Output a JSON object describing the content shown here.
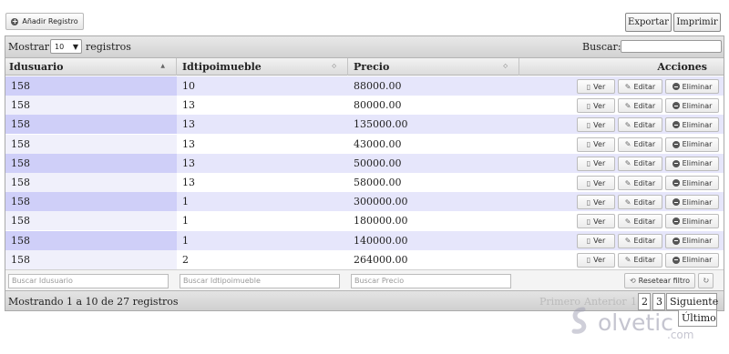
{
  "top": {
    "add_label": "Añadir Registro",
    "export_label": "Exportar",
    "print_label": "Imprimir"
  },
  "toolbar": {
    "show_label": "Mostrar",
    "page_length": "10",
    "records_label": "registros",
    "search_label": "Buscar:",
    "search_value": ""
  },
  "columns": {
    "c1": "Idusuario",
    "c2": "Idtipoimueble",
    "c3": "Precio",
    "c4": "Acciones"
  },
  "rows": [
    [
      "158",
      "10",
      "88000.00"
    ],
    [
      "158",
      "13",
      "80000.00"
    ],
    [
      "158",
      "13",
      "135000.00"
    ],
    [
      "158",
      "13",
      "43000.00"
    ],
    [
      "158",
      "13",
      "50000.00"
    ],
    [
      "158",
      "13",
      "58000.00"
    ],
    [
      "158",
      "1",
      "300000.00"
    ],
    [
      "158",
      "1",
      "180000.00"
    ],
    [
      "158",
      "1",
      "140000.00"
    ],
    [
      "158",
      "2",
      "264000.00"
    ]
  ],
  "actions": {
    "view": "Ver",
    "edit": "Editar",
    "delete": "Eliminar"
  },
  "filters": {
    "f1": "Buscar Idusuario",
    "f2": "Buscar Idtipoimueble",
    "f3": "Buscar Precio",
    "reset": "Resetear filtro"
  },
  "footer": {
    "info": "Mostrando 1 a 10 de 27 registros",
    "first": "Primero",
    "prev": "Anterior",
    "p1": "1",
    "p2": "2",
    "p3": "3",
    "next": "Siguiente",
    "last": "Último"
  },
  "watermark": {
    "text": "olvetic",
    "suffix": ".com"
  }
}
